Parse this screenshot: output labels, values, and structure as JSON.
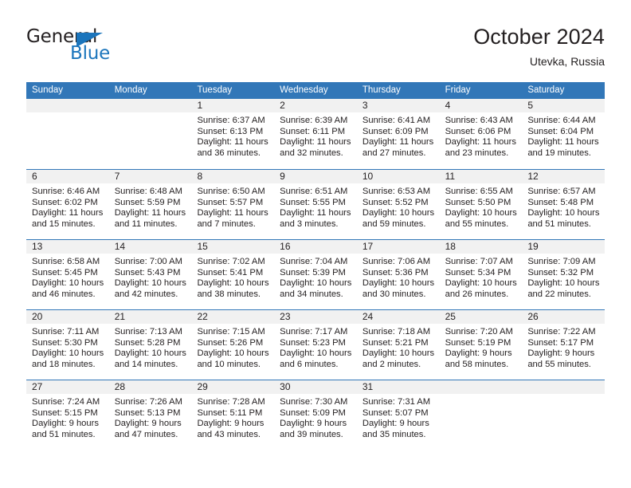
{
  "brand": {
    "name_part1": "General",
    "name_part2": "Blue"
  },
  "header": {
    "title": "October 2024",
    "location": "Utevka, Russia"
  },
  "colors": {
    "header_blue": "#3277b8",
    "brand_blue": "#1b75bc",
    "daynum_band": "#f1f1f1",
    "text": "#231f20"
  },
  "weekdays": [
    "Sunday",
    "Monday",
    "Tuesday",
    "Wednesday",
    "Thursday",
    "Friday",
    "Saturday"
  ],
  "weeks": [
    [
      {
        "day": "",
        "lines": []
      },
      {
        "day": "",
        "lines": []
      },
      {
        "day": "1",
        "lines": [
          "Sunrise: 6:37 AM",
          "Sunset: 6:13 PM",
          "Daylight: 11 hours",
          "and 36 minutes."
        ]
      },
      {
        "day": "2",
        "lines": [
          "Sunrise: 6:39 AM",
          "Sunset: 6:11 PM",
          "Daylight: 11 hours",
          "and 32 minutes."
        ]
      },
      {
        "day": "3",
        "lines": [
          "Sunrise: 6:41 AM",
          "Sunset: 6:09 PM",
          "Daylight: 11 hours",
          "and 27 minutes."
        ]
      },
      {
        "day": "4",
        "lines": [
          "Sunrise: 6:43 AM",
          "Sunset: 6:06 PM",
          "Daylight: 11 hours",
          "and 23 minutes."
        ]
      },
      {
        "day": "5",
        "lines": [
          "Sunrise: 6:44 AM",
          "Sunset: 6:04 PM",
          "Daylight: 11 hours",
          "and 19 minutes."
        ]
      }
    ],
    [
      {
        "day": "6",
        "lines": [
          "Sunrise: 6:46 AM",
          "Sunset: 6:02 PM",
          "Daylight: 11 hours",
          "and 15 minutes."
        ]
      },
      {
        "day": "7",
        "lines": [
          "Sunrise: 6:48 AM",
          "Sunset: 5:59 PM",
          "Daylight: 11 hours",
          "and 11 minutes."
        ]
      },
      {
        "day": "8",
        "lines": [
          "Sunrise: 6:50 AM",
          "Sunset: 5:57 PM",
          "Daylight: 11 hours",
          "and 7 minutes."
        ]
      },
      {
        "day": "9",
        "lines": [
          "Sunrise: 6:51 AM",
          "Sunset: 5:55 PM",
          "Daylight: 11 hours",
          "and 3 minutes."
        ]
      },
      {
        "day": "10",
        "lines": [
          "Sunrise: 6:53 AM",
          "Sunset: 5:52 PM",
          "Daylight: 10 hours",
          "and 59 minutes."
        ]
      },
      {
        "day": "11",
        "lines": [
          "Sunrise: 6:55 AM",
          "Sunset: 5:50 PM",
          "Daylight: 10 hours",
          "and 55 minutes."
        ]
      },
      {
        "day": "12",
        "lines": [
          "Sunrise: 6:57 AM",
          "Sunset: 5:48 PM",
          "Daylight: 10 hours",
          "and 51 minutes."
        ]
      }
    ],
    [
      {
        "day": "13",
        "lines": [
          "Sunrise: 6:58 AM",
          "Sunset: 5:45 PM",
          "Daylight: 10 hours",
          "and 46 minutes."
        ]
      },
      {
        "day": "14",
        "lines": [
          "Sunrise: 7:00 AM",
          "Sunset: 5:43 PM",
          "Daylight: 10 hours",
          "and 42 minutes."
        ]
      },
      {
        "day": "15",
        "lines": [
          "Sunrise: 7:02 AM",
          "Sunset: 5:41 PM",
          "Daylight: 10 hours",
          "and 38 minutes."
        ]
      },
      {
        "day": "16",
        "lines": [
          "Sunrise: 7:04 AM",
          "Sunset: 5:39 PM",
          "Daylight: 10 hours",
          "and 34 minutes."
        ]
      },
      {
        "day": "17",
        "lines": [
          "Sunrise: 7:06 AM",
          "Sunset: 5:36 PM",
          "Daylight: 10 hours",
          "and 30 minutes."
        ]
      },
      {
        "day": "18",
        "lines": [
          "Sunrise: 7:07 AM",
          "Sunset: 5:34 PM",
          "Daylight: 10 hours",
          "and 26 minutes."
        ]
      },
      {
        "day": "19",
        "lines": [
          "Sunrise: 7:09 AM",
          "Sunset: 5:32 PM",
          "Daylight: 10 hours",
          "and 22 minutes."
        ]
      }
    ],
    [
      {
        "day": "20",
        "lines": [
          "Sunrise: 7:11 AM",
          "Sunset: 5:30 PM",
          "Daylight: 10 hours",
          "and 18 minutes."
        ]
      },
      {
        "day": "21",
        "lines": [
          "Sunrise: 7:13 AM",
          "Sunset: 5:28 PM",
          "Daylight: 10 hours",
          "and 14 minutes."
        ]
      },
      {
        "day": "22",
        "lines": [
          "Sunrise: 7:15 AM",
          "Sunset: 5:26 PM",
          "Daylight: 10 hours",
          "and 10 minutes."
        ]
      },
      {
        "day": "23",
        "lines": [
          "Sunrise: 7:17 AM",
          "Sunset: 5:23 PM",
          "Daylight: 10 hours",
          "and 6 minutes."
        ]
      },
      {
        "day": "24",
        "lines": [
          "Sunrise: 7:18 AM",
          "Sunset: 5:21 PM",
          "Daylight: 10 hours",
          "and 2 minutes."
        ]
      },
      {
        "day": "25",
        "lines": [
          "Sunrise: 7:20 AM",
          "Sunset: 5:19 PM",
          "Daylight: 9 hours",
          "and 58 minutes."
        ]
      },
      {
        "day": "26",
        "lines": [
          "Sunrise: 7:22 AM",
          "Sunset: 5:17 PM",
          "Daylight: 9 hours",
          "and 55 minutes."
        ]
      }
    ],
    [
      {
        "day": "27",
        "lines": [
          "Sunrise: 7:24 AM",
          "Sunset: 5:15 PM",
          "Daylight: 9 hours",
          "and 51 minutes."
        ]
      },
      {
        "day": "28",
        "lines": [
          "Sunrise: 7:26 AM",
          "Sunset: 5:13 PM",
          "Daylight: 9 hours",
          "and 47 minutes."
        ]
      },
      {
        "day": "29",
        "lines": [
          "Sunrise: 7:28 AM",
          "Sunset: 5:11 PM",
          "Daylight: 9 hours",
          "and 43 minutes."
        ]
      },
      {
        "day": "30",
        "lines": [
          "Sunrise: 7:30 AM",
          "Sunset: 5:09 PM",
          "Daylight: 9 hours",
          "and 39 minutes."
        ]
      },
      {
        "day": "31",
        "lines": [
          "Sunrise: 7:31 AM",
          "Sunset: 5:07 PM",
          "Daylight: 9 hours",
          "and 35 minutes."
        ]
      },
      {
        "day": "",
        "lines": []
      },
      {
        "day": "",
        "lines": []
      }
    ]
  ]
}
